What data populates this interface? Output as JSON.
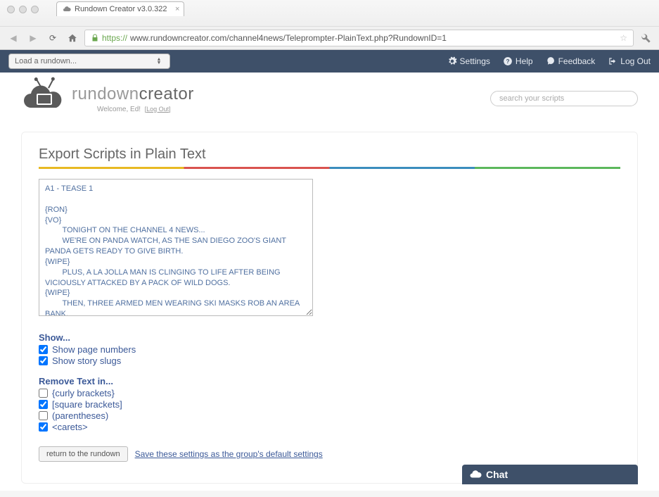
{
  "browser": {
    "tab_title": "Rundown Creator v3.0.322",
    "url_display": "www.rundowncreator.com/channel4news/Teleprompter-PlainText.php?RundownID=1",
    "protocol": "https://"
  },
  "toolbar": {
    "rundown_loader": "Load a rundown...",
    "settings": "Settings",
    "help": "Help",
    "feedback": "Feedback",
    "logout": "Log Out"
  },
  "header": {
    "logo_light": "rundown",
    "logo_dark": "creator",
    "welcome": "Welcome, Ed!",
    "logout_link": "[Log Out]",
    "search_placeholder": "search your scripts"
  },
  "page": {
    "title": "Export Scripts in Plain Text",
    "script_text": "A1 - TEASE 1\n\n{RON}\n{VO}\n        TONIGHT ON THE CHANNEL 4 NEWS...\n        WE'RE ON PANDA WATCH, AS THE SAN DIEGO ZOO'S GIANT PANDA GETS READY TO GIVE BIRTH.\n{WIPE}\n        PLUS, A LA JOLLA MAN IS CLINGING TO LIFE AFTER BEING VICIOUSLY ATTACKED BY A PACK OF WILD DOGS.\n{WIPE}\n        THEN, THREE ARMED MEN WEARING SKI MASKS ROB AN AREA BANK.\n{WIPE}\n        AND LATER, AN AQUATIC DAREDEVIL--\n        "
  },
  "options": {
    "show_header": "Show...",
    "show_page_numbers": {
      "label": "Show page numbers",
      "checked": true
    },
    "show_story_slugs": {
      "label": "Show story slugs",
      "checked": true
    },
    "remove_header": "Remove Text in...",
    "curly": {
      "label": "{curly brackets}",
      "checked": false
    },
    "square": {
      "label": "[square brackets]",
      "checked": true
    },
    "paren": {
      "label": "(parentheses)",
      "checked": false
    },
    "carets": {
      "label": "<carets>",
      "checked": true
    }
  },
  "actions": {
    "return_btn": "return to the rundown",
    "save_link": "Save these settings as the group's default settings"
  },
  "chat": {
    "label": "Chat"
  }
}
